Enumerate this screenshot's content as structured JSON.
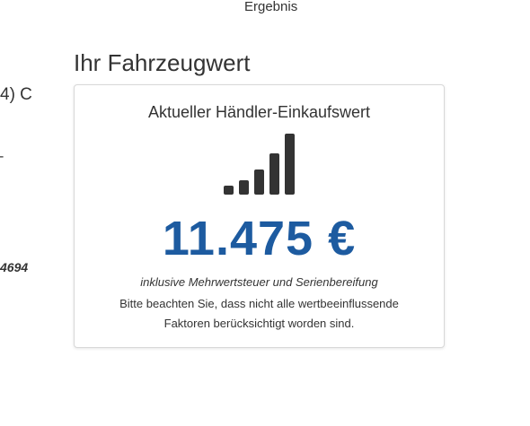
{
  "header": {
    "tab_label": "Ergebnis"
  },
  "left_fragments": {
    "line1": "4) C",
    "line2": "-",
    "line3": "4694"
  },
  "section": {
    "title": "Ihr Fahrzeugwert"
  },
  "card": {
    "heading": "Aktueller Händler-Einkaufswert",
    "signal_icon": "signal-strength-icon",
    "signal_level": 5,
    "price": "11.475 €",
    "note_italic": "inklusive Mehrwertsteuer und Serienbereifung",
    "note_line1": "Bitte beachten Sie, dass nicht alle wertbeeinflussende",
    "note_line2": "Faktoren berücksichtigt worden sind."
  },
  "colors": {
    "price": "#1d5ba0",
    "text": "#333333",
    "card_border": "#d8d8d8"
  }
}
